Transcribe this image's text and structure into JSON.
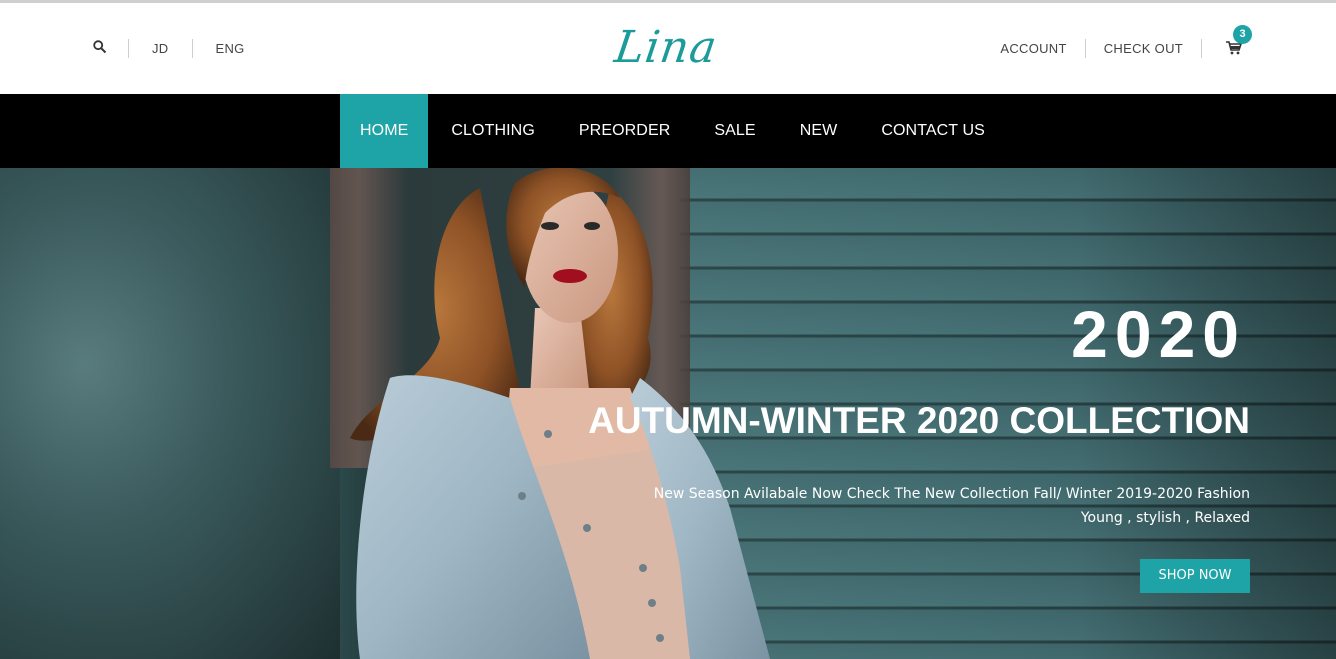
{
  "header": {
    "currency": "JD",
    "language": "ENG",
    "logo_text": "Lina",
    "account_label": "ACCOUNT",
    "checkout_label": "CHECK OUT",
    "cart_count": "3"
  },
  "nav": {
    "items": [
      {
        "label": "HOME",
        "active": true
      },
      {
        "label": "CLOTHING"
      },
      {
        "label": "PREORDER"
      },
      {
        "label": "SALE"
      },
      {
        "label": "NEW"
      },
      {
        "label": "CONTACT US"
      }
    ]
  },
  "hero": {
    "year": "2020",
    "title": "AUTUMN-WINTER 2020 COLLECTION",
    "subtitle_line1": "New Season Avilabale Now Check The New Collection Fall/ Winter 2019-2020 Fashion",
    "subtitle_line2": "Young , stylish , Relaxed",
    "cta_label": "SHOP NOW"
  },
  "colors": {
    "accent": "#1ea4a6",
    "nav_background": "#000000"
  },
  "icons": {
    "search": "search-icon",
    "cart": "cart-icon"
  }
}
